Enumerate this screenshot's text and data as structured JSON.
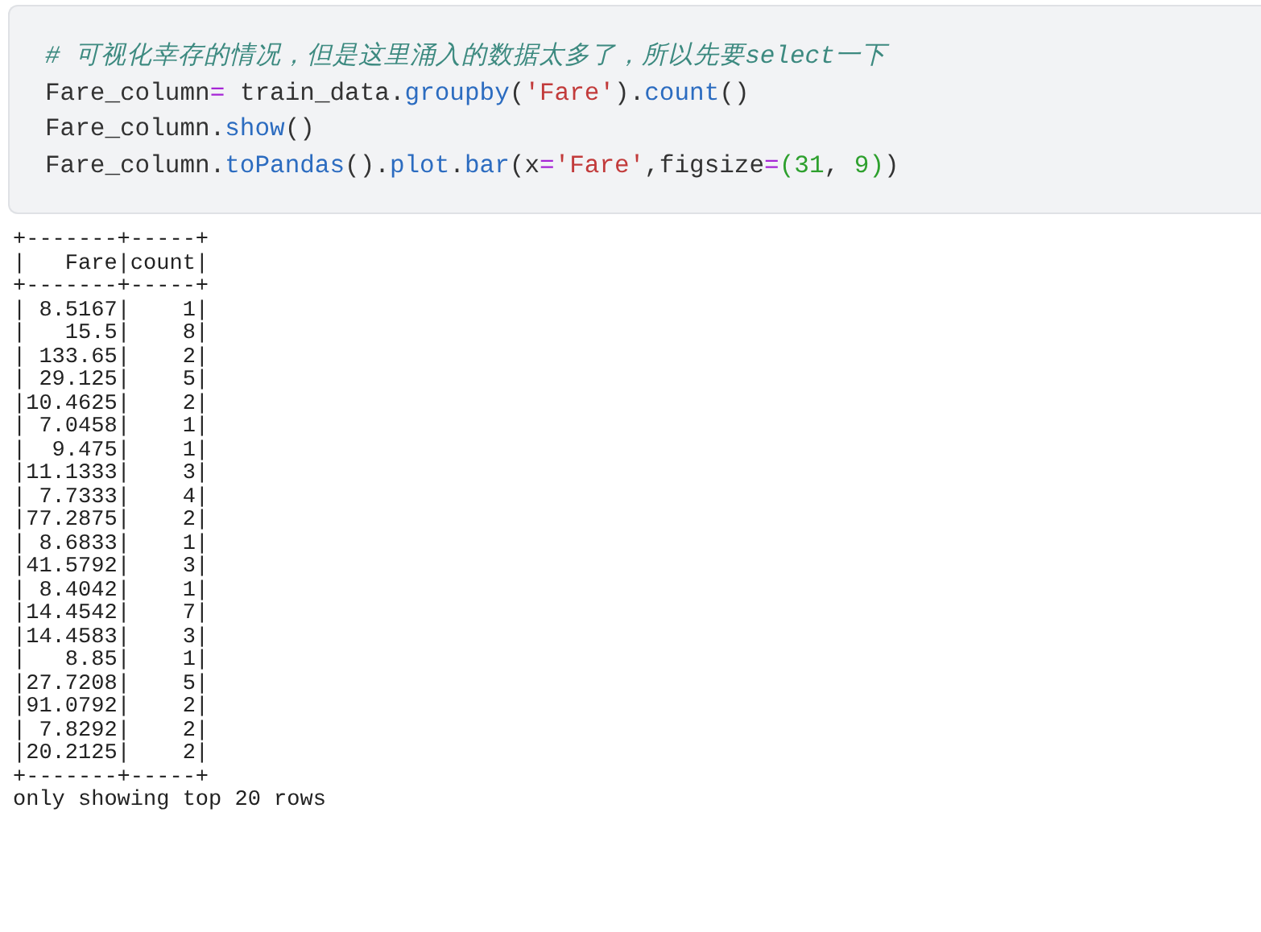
{
  "code_cell": {
    "lines": [
      [
        {
          "kind": "comment",
          "text": "# 可视化幸存的情况，但是这里涌入的数据太多了，所以先要select一下"
        }
      ],
      [
        {
          "kind": "plain",
          "text": "Fare_column"
        },
        {
          "kind": "operator",
          "text": "="
        },
        {
          "kind": "plain",
          "text": " train_data."
        },
        {
          "kind": "function",
          "text": "groupby"
        },
        {
          "kind": "plain",
          "text": "("
        },
        {
          "kind": "string",
          "text": "'Fare'"
        },
        {
          "kind": "plain",
          "text": ")."
        },
        {
          "kind": "function",
          "text": "count"
        },
        {
          "kind": "plain",
          "text": "()"
        }
      ],
      [
        {
          "kind": "plain",
          "text": "Fare_column."
        },
        {
          "kind": "function",
          "text": "show"
        },
        {
          "kind": "plain",
          "text": "()"
        }
      ],
      [
        {
          "kind": "plain",
          "text": "Fare_column."
        },
        {
          "kind": "function",
          "text": "toPandas"
        },
        {
          "kind": "plain",
          "text": "()."
        },
        {
          "kind": "function",
          "text": "plot"
        },
        {
          "kind": "plain",
          "text": "."
        },
        {
          "kind": "function",
          "text": "bar"
        },
        {
          "kind": "plain",
          "text": "(x"
        },
        {
          "kind": "operator",
          "text": "="
        },
        {
          "kind": "string",
          "text": "'Fare'"
        },
        {
          "kind": "plain",
          "text": ",figsize"
        },
        {
          "kind": "operator",
          "text": "="
        },
        {
          "kind": "number",
          "text": "("
        },
        {
          "kind": "number",
          "text": "31"
        },
        {
          "kind": "plain",
          "text": ", "
        },
        {
          "kind": "number",
          "text": "9"
        },
        {
          "kind": "number",
          "text": ")"
        },
        {
          "kind": "plain",
          "text": ")"
        }
      ]
    ]
  },
  "output": {
    "lines": [
      "+-------+-----+",
      "|   Fare|count|",
      "+-------+-----+",
      "| 8.5167|    1|",
      "|   15.5|    8|",
      "| 133.65|    2|",
      "| 29.125|    5|",
      "|10.4625|    2|",
      "| 7.0458|    1|",
      "|  9.475|    1|",
      "|11.1333|    3|",
      "| 7.7333|    4|",
      "|77.2875|    2|",
      "| 8.6833|    1|",
      "|41.5792|    3|",
      "| 8.4042|    1|",
      "|14.4542|    7|",
      "|14.4583|    3|",
      "|   8.85|    1|",
      "|27.7208|    5|",
      "|91.0792|    2|",
      "| 7.8292|    2|",
      "|20.2125|    2|",
      "+-------+-----+",
      "only showing top 20 rows"
    ]
  }
}
